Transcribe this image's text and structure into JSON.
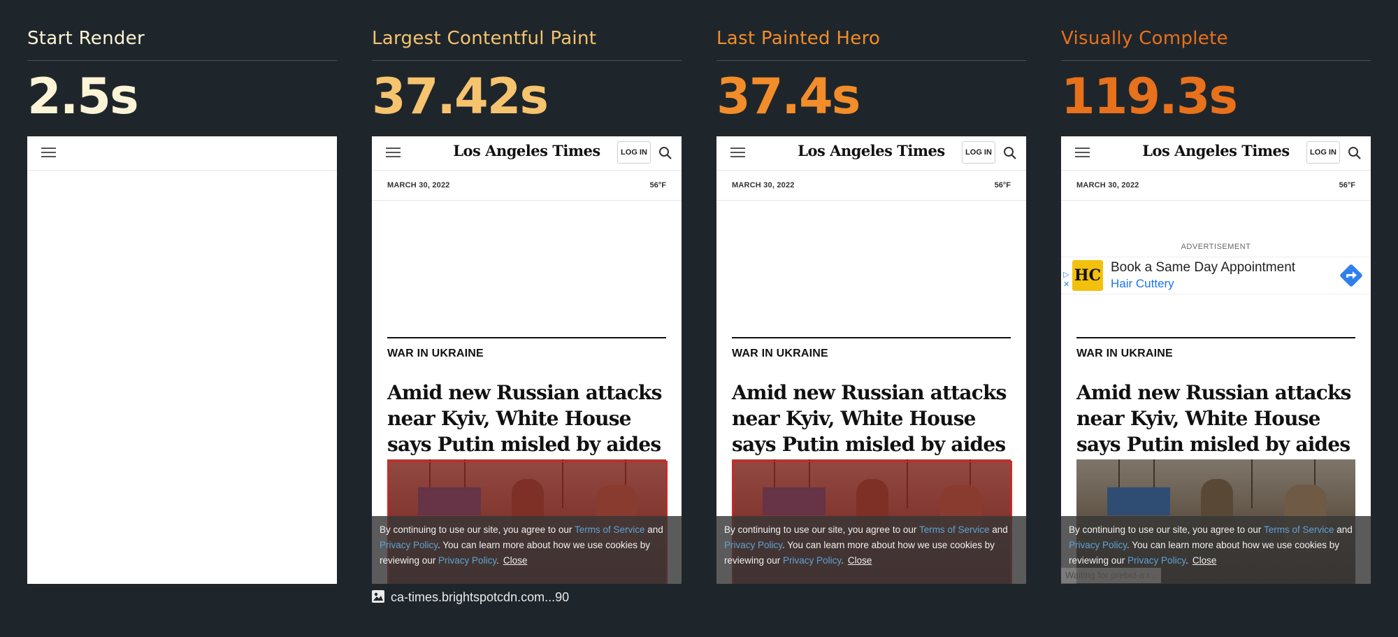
{
  "colors": {
    "background": "#1f262b",
    "start_render": "#fcf4d6",
    "largest_contentful_paint": "#f6c36e",
    "last_painted_hero": "#f28d2a",
    "visually_complete": "#e8711c"
  },
  "metrics": [
    {
      "title": "Start Render",
      "value": "2.5s"
    },
    {
      "title": "Largest Contentful Paint",
      "value": "37.42s"
    },
    {
      "title": "Last Painted Hero",
      "value": "37.4s"
    },
    {
      "title": "Visually Complete",
      "value": "119.3s"
    }
  ],
  "page": {
    "logo": "Los Angeles Times",
    "login_label": "LOG IN",
    "menu_icon": "hamburger-menu-icon",
    "search_icon": "search-icon",
    "date": "MARCH 30, 2022",
    "temperature": "56°F",
    "kicker": "WAR IN UKRAINE",
    "headline": "Amid new Russian attacks near Kyiv, White House says Putin misled by aides",
    "cookie": {
      "text_1": "By continuing to use our site, you agree to our ",
      "terms": "Terms of Service",
      "text_2": " and ",
      "privacy": "Privacy Policy",
      "text_3": ". You can learn more about how we use cookies by reviewing our ",
      "privacy_2": "Privacy Policy",
      "text_4": ".",
      "close": "Close"
    },
    "ad": {
      "label": "ADVERTISEMENT",
      "logo_text": "HC",
      "title": "Book a Same Day Appointment",
      "subtitle": "Hair Cuttery"
    },
    "waiting": "Waiting for prebid-a.r..."
  },
  "caption": {
    "icon": "image-icon",
    "text": "ca-times.brightspotcdn.com...90"
  }
}
